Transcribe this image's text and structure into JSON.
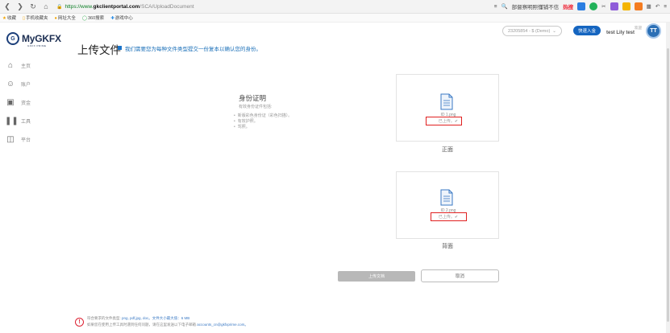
{
  "browser": {
    "url_prefix": "https://www.",
    "url_domain": "gkclientportal.com",
    "url_path": "/SCA/UploadDocument",
    "search_text": "部督察明照懂铺不信",
    "hot_label": "热搜",
    "bookmarks": [
      "收藏",
      "手机收藏夹",
      "网址大全",
      "360搜索",
      "游戏中心"
    ]
  },
  "sidebar": {
    "logo": "MyGKFX",
    "logo_sub": "GKFX PRIME",
    "items": [
      {
        "label": "主页",
        "icon": "home-icon"
      },
      {
        "label": "账户",
        "icon": "user-icon"
      },
      {
        "label": "资金",
        "icon": "wallet-icon"
      },
      {
        "label": "工具",
        "icon": "tools-icon"
      },
      {
        "label": "平台",
        "icon": "platform-icon"
      }
    ]
  },
  "header": {
    "title": "上传文件",
    "subtitle": "我们需要您为每种文件类型提交一份复本以确认您的身份。",
    "account_selector": "23205854 - $ (Demo)",
    "deposit_button": "快速入金",
    "welcome": "欢迎",
    "user_name": "test Lily test",
    "avatar_initials": "TT"
  },
  "document": {
    "title": "身份证明",
    "description": "有效身份证件包括:",
    "options": [
      "新版彩色身份证（彩色扫描）。",
      "有效护照。",
      "驾照。"
    ]
  },
  "uploads": [
    {
      "file_name": "ID 1.png",
      "status": "已上传。✔",
      "caption": "正面"
    },
    {
      "file_name": "ID 2.png",
      "status": "已上传。✔",
      "caption": "背面"
    }
  ],
  "actions": {
    "upload_label": "上传文档",
    "cancel_label": "取消"
  },
  "footer": {
    "line1_prefix": "符合要求的文件类型:",
    "line1_types": "png, pdf,jpg, doc。文件大小最大值：6 MB",
    "line2_prefix": "如果您在使用上传工具时遇到任何问题，请在这里发送以下电子邮箱",
    "line2_email": "accounts_cn@gkfxprime.com。"
  },
  "colors": {
    "accent": "#1565c0",
    "highlight_box": "#e02020"
  }
}
